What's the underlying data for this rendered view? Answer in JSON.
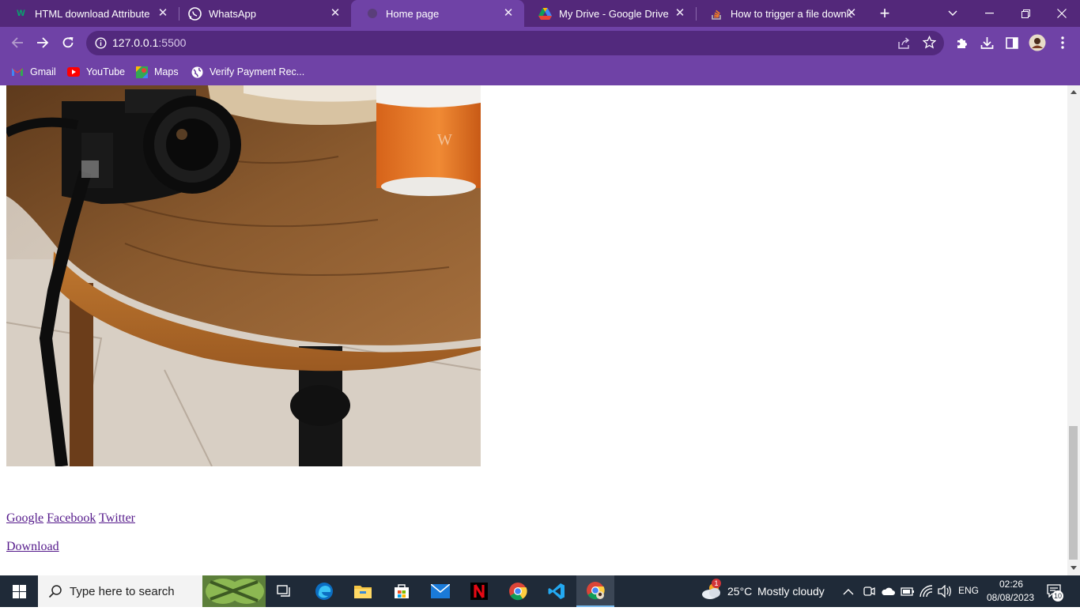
{
  "tabs": [
    {
      "title": "HTML download Attribute",
      "favicon": "w3schools-icon",
      "active": false
    },
    {
      "title": "WhatsApp",
      "favicon": "whatsapp-icon",
      "active": false
    },
    {
      "title": "Home page",
      "favicon": "globe-icon",
      "active": true
    },
    {
      "title": "My Drive - Google Drive",
      "favicon": "google-drive-icon",
      "active": false
    },
    {
      "title": "How to trigger a file downlo",
      "favicon": "stackoverflow-icon",
      "active": false
    }
  ],
  "address_bar": {
    "host": "127.0.0.1",
    "port": ":5500"
  },
  "bookmarks": [
    {
      "label": "Gmail",
      "icon": "gmail-icon"
    },
    {
      "label": "YouTube",
      "icon": "youtube-icon"
    },
    {
      "label": "Maps",
      "icon": "maps-icon"
    },
    {
      "label": "Verify Payment Rec...",
      "icon": "globe-icon"
    }
  ],
  "page": {
    "links": [
      "Google",
      "Facebook",
      "Twitter"
    ],
    "download_label": "Download",
    "photo_alt": "camera-and-coffee-on-table-photo"
  },
  "taskbar": {
    "search_placeholder": "Type here to search",
    "weather": {
      "temp": "25°C",
      "condition": "Mostly cloudy",
      "badge": "1"
    },
    "language": "ENG",
    "time": "02:26",
    "date": "08/08/2023",
    "notifications": "10"
  },
  "colors": {
    "tabstrip": "#53287a",
    "toolbar": "#6f42a6",
    "omnibox": "#52297d",
    "visited_link": "#551a8b",
    "taskbar": "#1f2a38"
  }
}
